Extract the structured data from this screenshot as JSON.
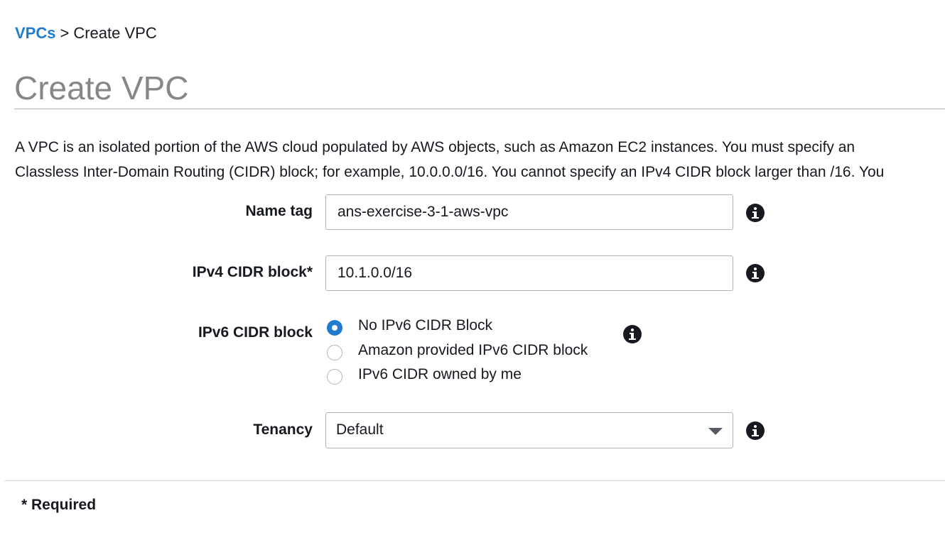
{
  "breadcrumb": {
    "parent": "VPCs",
    "separator": ">",
    "current": "Create VPC"
  },
  "page": {
    "title": "Create VPC"
  },
  "description": {
    "line1": "A VPC is an isolated portion of the AWS cloud populated by AWS objects, such as Amazon EC2 instances. You must specify an",
    "line2": "Classless Inter-Domain Routing (CIDR) block; for example, 10.0.0.0/16. You cannot specify an IPv4 CIDR block larger than /16. You"
  },
  "form": {
    "name_tag": {
      "label": "Name tag",
      "value": "ans-exercise-3-1-aws-vpc"
    },
    "ipv4_cidr": {
      "label": "IPv4 CIDR block*",
      "value": "10.1.0.0/16"
    },
    "ipv6_cidr": {
      "label": "IPv6 CIDR block",
      "options": [
        {
          "label": "No IPv6 CIDR Block",
          "checked": true
        },
        {
          "label": "Amazon provided IPv6 CIDR block",
          "checked": false
        },
        {
          "label": "IPv6 CIDR owned by me",
          "checked": false
        }
      ]
    },
    "tenancy": {
      "label": "Tenancy",
      "value": "Default"
    }
  },
  "footer": {
    "required_note": "* Required"
  },
  "icons": {
    "info": "info-icon",
    "dropdown": "chevron-down-icon"
  },
  "colors": {
    "link": "#1f7ccf",
    "title": "#878787",
    "radio_selected": "#1f7ccf"
  }
}
